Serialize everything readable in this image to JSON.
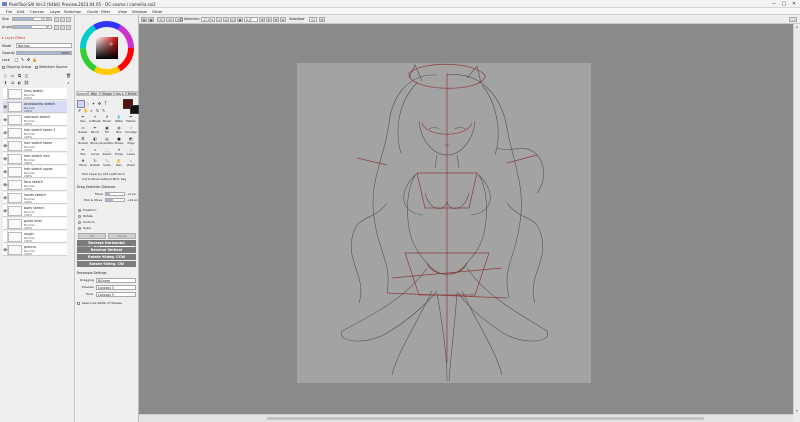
{
  "window": {
    "title": "PaintTool SAI Ver.2 (64bit) Preview.2023.04.05 - OC-cosmo / camellia.sai2",
    "minimize": "─",
    "maximize": "□",
    "close": "✕"
  },
  "menu": [
    "File",
    "Edit",
    "Canvas",
    "Layer",
    "Selection",
    "Guide",
    "Filter",
    "View",
    "Window",
    "Other"
  ],
  "left": {
    "size_label": "Size",
    "size_value": "17.0%",
    "angle_label": "Angle",
    "angle_value": "0°",
    "layer_effect": "▸ Layer Effect",
    "mode_label": "Mode",
    "mode_value": "Normal",
    "opacity_label": "Opacity",
    "opacity_value": "100%",
    "lock_label": "Lock",
    "clipping_label": "Clipping Group",
    "selection_source_label": "Selection Source",
    "layers": [
      {
        "name": "lines sketch",
        "mode": "Normal",
        "opacity": "100%",
        "eye": "",
        "sel": false
      },
      {
        "name": "accessories sketch",
        "mode": "Normal",
        "opacity": "100%",
        "eye": "👁",
        "sel": true
      },
      {
        "name": "swimsuit sketch",
        "mode": "Normal",
        "opacity": "100%",
        "eye": "👁",
        "sel": false
      },
      {
        "name": "hair sketch lower 2",
        "mode": "Normal",
        "opacity": "100%",
        "eye": "👁",
        "sel": false
      },
      {
        "name": "hair sketch lower",
        "mode": "Normal",
        "opacity": "100%",
        "eye": "👁",
        "sel": false
      },
      {
        "name": "hair sketch mid",
        "mode": "Normal",
        "opacity": "100%",
        "eye": "👁",
        "sel": false
      },
      {
        "name": "hair sketch upper",
        "mode": "Normal",
        "opacity": "100%",
        "eye": "👁",
        "sel": false
      },
      {
        "name": "face sketch",
        "mode": "Normal",
        "opacity": "100%",
        "eye": "👁",
        "sel": false
      },
      {
        "name": "hands sketch",
        "mode": "Normal",
        "opacity": "100%",
        "eye": "👁",
        "sel": false
      },
      {
        "name": "body sketch",
        "mode": "Normal",
        "opacity": "100%",
        "eye": "👁",
        "sel": false
      },
      {
        "name": "guide lines",
        "mode": "Normal",
        "opacity": "100%",
        "eye": "",
        "sel": false
      },
      {
        "name": "rough",
        "mode": "Normal",
        "opacity": "100%",
        "eye": "",
        "sel": false
      },
      {
        "name": "ground",
        "mode": "Normal",
        "opacity": "100%",
        "eye": "👁",
        "sel": false
      }
    ]
  },
  "mid": {
    "tabs": [
      "Select",
      "Bdy",
      "Shape",
      "Ins 1",
      "BrSet"
    ],
    "tools": [
      [
        "Pen",
        "AirBrush",
        "Brush",
        "Water",
        "Marker"
      ],
      [
        "Eraser",
        "Pencil",
        "Fill",
        "Blur",
        "Smudge"
      ],
      [
        "Bucket",
        "Binary",
        "Gradation",
        "Shape",
        "Edge"
      ],
      [
        "Pen",
        "Curve",
        "Select",
        "Erase",
        "Lasso"
      ],
      [
        "Move",
        "Rotate",
        "Scale",
        "Nav",
        "Zoom"
      ]
    ],
    "pick_layer": "Pick Layer by Ctrl+Left-Click",
    "cut_move": "Cut & Move without Mod. Key",
    "drag_sel_title": "Drag Selection Distance",
    "move_label": "Move",
    "move_value": "+0 px",
    "pick_move_label": "Pick & Move",
    "pick_move_value": "+10 px",
    "radios": [
      "Freeform",
      "Rotate",
      "Uniform",
      "Scale"
    ],
    "ok": "OK",
    "cancel": "Cancel",
    "perspective_label": "Perspective",
    "perspective_value": "0",
    "btn_reverse_h": "Reverse Horizontal",
    "btn_reverse_v": "Reverse Vertical",
    "btn_rot_ccw": "Rotate 90deg. CCW",
    "btn_rot_cw": "Rotate 90deg. CW",
    "resample_title": "Resample Settings",
    "dragging_label": "Dragging",
    "dragging_value": "Bilinear",
    "preview_label": "Preview",
    "preview_value": "Lanczos 3",
    "final_label": "Final",
    "final_value": "Lanczos 3",
    "keep_width": "Keep Line Width of Shapes"
  },
  "toolbar": {
    "selection_label": "Selection",
    "zoom_value": "17.0%",
    "angle_value": "0.0°",
    "stabilizer_label": "Stabilizer",
    "stabilizer_value": "S3"
  },
  "colors": {
    "primary": "#5a0b0b",
    "secondary": "#111111",
    "selected_layer": "#d8dcf4",
    "action_buttons": "#7c7c7c"
  }
}
